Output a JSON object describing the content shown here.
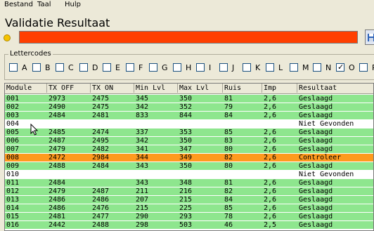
{
  "menu": [
    "Bestand",
    "Taal",
    "Hulp"
  ],
  "title": "Validatie Resultaat",
  "colors": {
    "ok": "#8ee68e",
    "fail": "#ffffff",
    "check": "#ff9a1e",
    "bar": "#ff3f00"
  },
  "letters": {
    "label": "Lettercodes",
    "items": [
      {
        "l": "A",
        "c": false
      },
      {
        "l": "B",
        "c": false
      },
      {
        "l": "C",
        "c": false
      },
      {
        "l": "D",
        "c": false
      },
      {
        "l": "E",
        "c": false
      },
      {
        "l": "F",
        "c": false
      },
      {
        "l": "G",
        "c": false
      },
      {
        "l": "H",
        "c": false
      },
      {
        "l": "I",
        "c": false
      },
      {
        "l": "J",
        "c": false
      },
      {
        "l": "K",
        "c": false
      },
      {
        "l": "L",
        "c": false
      },
      {
        "l": "M",
        "c": false
      },
      {
        "l": "N",
        "c": false
      },
      {
        "l": "O",
        "c": true
      },
      {
        "l": "P",
        "c": false
      }
    ]
  },
  "table": {
    "columns": [
      "Module",
      "TX OFF",
      "TX ON",
      "Min Lvl",
      "Max Lvl",
      "Ruis",
      "Imp",
      "Resultaat"
    ],
    "rows": [
      {
        "s": "ok",
        "c": [
          "001",
          "2973",
          "2475",
          "345",
          "350",
          "81",
          "2,6",
          "Geslaagd"
        ]
      },
      {
        "s": "ok",
        "c": [
          "002",
          "2490",
          "2475",
          "342",
          "352",
          "79",
          "2,6",
          "Geslaagd"
        ]
      },
      {
        "s": "ok",
        "c": [
          "003",
          "2484",
          "2481",
          "833",
          "844",
          "84",
          "2,6",
          "Geslaagd"
        ]
      },
      {
        "s": "fail",
        "c": [
          "004",
          "",
          "",
          "",
          "",
          "",
          "",
          "Niet Gevonden"
        ]
      },
      {
        "s": "ok",
        "c": [
          "005",
          "2485",
          "2474",
          "337",
          "353",
          "85",
          "2,6",
          "Geslaagd"
        ]
      },
      {
        "s": "ok",
        "c": [
          "006",
          "2487",
          "2495",
          "342",
          "350",
          "83",
          "2,6",
          "Geslaagd"
        ]
      },
      {
        "s": "ok",
        "c": [
          "007",
          "2479",
          "2482",
          "341",
          "347",
          "80",
          "2,6",
          "Geslaagd"
        ]
      },
      {
        "s": "check",
        "c": [
          "008",
          "2472",
          "2984",
          "344",
          "349",
          "82",
          "2,6",
          "Controleer"
        ]
      },
      {
        "s": "ok",
        "c": [
          "009",
          "2488",
          "2484",
          "343",
          "350",
          "80",
          "2,6",
          "Geslaagd"
        ]
      },
      {
        "s": "fail",
        "c": [
          "010",
          "",
          "",
          "",
          "",
          "",
          "",
          "Niet Gevonden"
        ]
      },
      {
        "s": "ok",
        "c": [
          "011",
          "2484",
          "",
          "343",
          "348",
          "81",
          "2,6",
          "Geslaagd"
        ]
      },
      {
        "s": "ok",
        "c": [
          "012",
          "2479",
          "2487",
          "211",
          "216",
          "82",
          "2,6",
          "Geslaagd"
        ]
      },
      {
        "s": "ok",
        "c": [
          "013",
          "2486",
          "2486",
          "207",
          "215",
          "84",
          "2,6",
          "Geslaagd"
        ]
      },
      {
        "s": "ok",
        "c": [
          "014",
          "2486",
          "2476",
          "215",
          "225",
          "85",
          "2,6",
          "Geslaagd"
        ]
      },
      {
        "s": "ok",
        "c": [
          "015",
          "2481",
          "2477",
          "290",
          "293",
          "78",
          "2,6",
          "Geslaagd"
        ]
      },
      {
        "s": "ok",
        "c": [
          "016",
          "2442",
          "2488",
          "298",
          "503",
          "46",
          "2,5",
          "Geslaagd"
        ]
      }
    ]
  }
}
